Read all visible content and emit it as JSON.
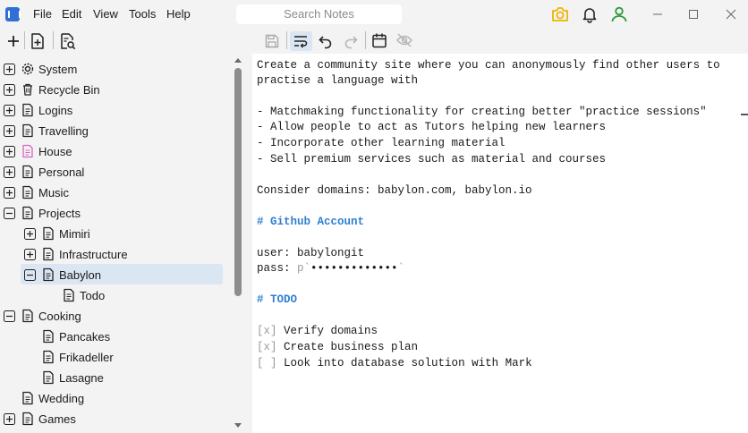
{
  "app": {
    "menus": [
      "File",
      "Edit",
      "View",
      "Tools",
      "Help"
    ]
  },
  "search": {
    "placeholder": "Search Notes"
  },
  "colors": {
    "accent": "#2f6fd6",
    "selection": "#dbe6f3",
    "heading": "#2f7fd0",
    "camera": "#f2b400",
    "user": "#2e9a3e"
  },
  "tree": [
    {
      "label": "System",
      "expander": "plus",
      "icon": "gear-icon"
    },
    {
      "label": "Recycle Bin",
      "expander": "plus",
      "icon": "trash-icon"
    },
    {
      "label": "Logins",
      "expander": "plus",
      "icon": "document-icon"
    },
    {
      "label": "Travelling",
      "expander": "plus",
      "icon": "document-icon"
    },
    {
      "label": "House",
      "expander": "plus",
      "icon": "pink-document-icon"
    },
    {
      "label": "Personal",
      "expander": "plus",
      "icon": "document-icon"
    },
    {
      "label": "Music",
      "expander": "plus",
      "icon": "document-icon"
    },
    {
      "label": "Projects",
      "expander": "minus",
      "icon": "document-icon"
    },
    {
      "label": "Mimiri",
      "expander": "plus",
      "icon": "document-icon"
    },
    {
      "label": "Infrastructure",
      "expander": "plus",
      "icon": "document-icon"
    },
    {
      "label": "Babylon",
      "expander": "minus",
      "icon": "document-icon",
      "selected": true
    },
    {
      "label": "Todo",
      "expander": "none",
      "icon": "document-icon"
    },
    {
      "label": "Cooking",
      "expander": "minus",
      "icon": "document-icon"
    },
    {
      "label": "Pancakes",
      "expander": "none",
      "icon": "document-icon"
    },
    {
      "label": "Frikadeller",
      "expander": "none",
      "icon": "document-icon"
    },
    {
      "label": "Lasagne",
      "expander": "none",
      "icon": "document-icon"
    },
    {
      "label": "Wedding",
      "expander": "none",
      "icon": "document-icon"
    },
    {
      "label": "Games",
      "expander": "plus",
      "icon": "document-icon"
    }
  ],
  "editor": {
    "lines": [
      "Create a community site where you can anonymously find other users to",
      "practise a language with",
      "",
      "- Matchmaking functionality for creating better \"practice sessions\"",
      "- Allow people to act as Tutors helping new learners",
      "- Incorporate other learning material",
      "- Sell premium services such as material and courses",
      "",
      "Consider domains: babylon.com, babylon.io",
      "",
      "# Github Account",
      "",
      "user: babylongit",
      "pass: ",
      "",
      "# TODO",
      "",
      "Verify domains",
      "Create business plan",
      "Look into database solution with Mark"
    ],
    "password_prefix": "p`",
    "password_mask": "•••••••••••••",
    "password_suffix": "`",
    "check_marks": [
      "[x]",
      "[x]",
      "[ ]"
    ]
  }
}
